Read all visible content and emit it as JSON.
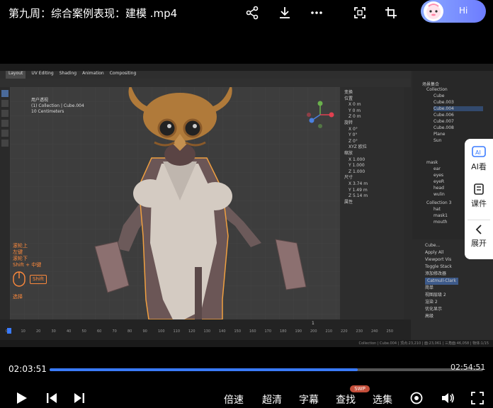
{
  "player": {
    "title": "第九周：综合案例表现：建模 .mp4",
    "hi_label": "Hi",
    "current_time": "02:03:51",
    "total_time": "02:54:51",
    "progress": 0.71,
    "controls": {
      "speed": "倍速",
      "quality": "超清",
      "subtitle": "字幕",
      "search": "查找",
      "search_badge": "SWP",
      "episodes": "选集"
    },
    "side_panel": {
      "ai": "AI看",
      "courseware": "课件",
      "expand": "展开"
    },
    "accent": "#3a7bff"
  },
  "blender": {
    "tabs": [
      "Layout",
      "UV Editing",
      "Shading",
      "Animation",
      "Compositing"
    ],
    "viewport_info": [
      "用户透视",
      "(1) Collection | Cube.004",
      "10 Centimeters"
    ],
    "nav_hint": [
      "滚轮上",
      "左键",
      "滚轮下",
      "Shift + 中键"
    ],
    "nav_key": "Shift",
    "nav_select": "选择",
    "outliner_rows": [
      "场景集合",
      "Collection",
      "Cube",
      "Cube.003",
      "Cube.004",
      "Cube.006",
      "Cube.007",
      "Cube.008",
      "Plane",
      "Sun",
      "mask",
      "ear",
      "eyes",
      "eyeR",
      "head",
      "wulin",
      "Collection 3",
      "hat",
      "mask1",
      "mouth"
    ],
    "n_panel": {
      "header": "变换",
      "location_label": "位置",
      "loc": [
        "X 0 m",
        "Y 0 m",
        "Z 0 m"
      ],
      "rotation_label": "旋转",
      "rot": [
        "X 0°",
        "Y 0°",
        "Z 0°"
      ],
      "mode": "XYZ 欧拉",
      "scale_label": "缩放",
      "scale": [
        "X 1.000",
        "Y 1.000",
        "Z 1.000"
      ],
      "dims_label": "尺寸",
      "dims": [
        "X 3.74 m",
        "Y 1.49 m",
        "Z 5.14 m"
      ],
      "props_label": "属性"
    },
    "props_rows": [
      "Cube...",
      "Apply All",
      "Viewport Vis",
      "Toggle Stack",
      "添加修改器",
      "Catmull-Clark",
      "简单",
      "视图层级 2",
      "渲染 2",
      "优化显示",
      "高级"
    ],
    "timeline_current": "1",
    "timeline_ticks": [
      "0",
      "10",
      "20",
      "30",
      "40",
      "50",
      "60",
      "70",
      "80",
      "90",
      "100",
      "110",
      "120",
      "130",
      "140",
      "150",
      "160",
      "170",
      "180",
      "190",
      "200",
      "210",
      "220",
      "230",
      "240",
      "250"
    ],
    "statusbar": "Collection | Cube.004 | 顶点:23,210 | 面:23,061 | 三角面:46,058 | 物体:1/15"
  }
}
